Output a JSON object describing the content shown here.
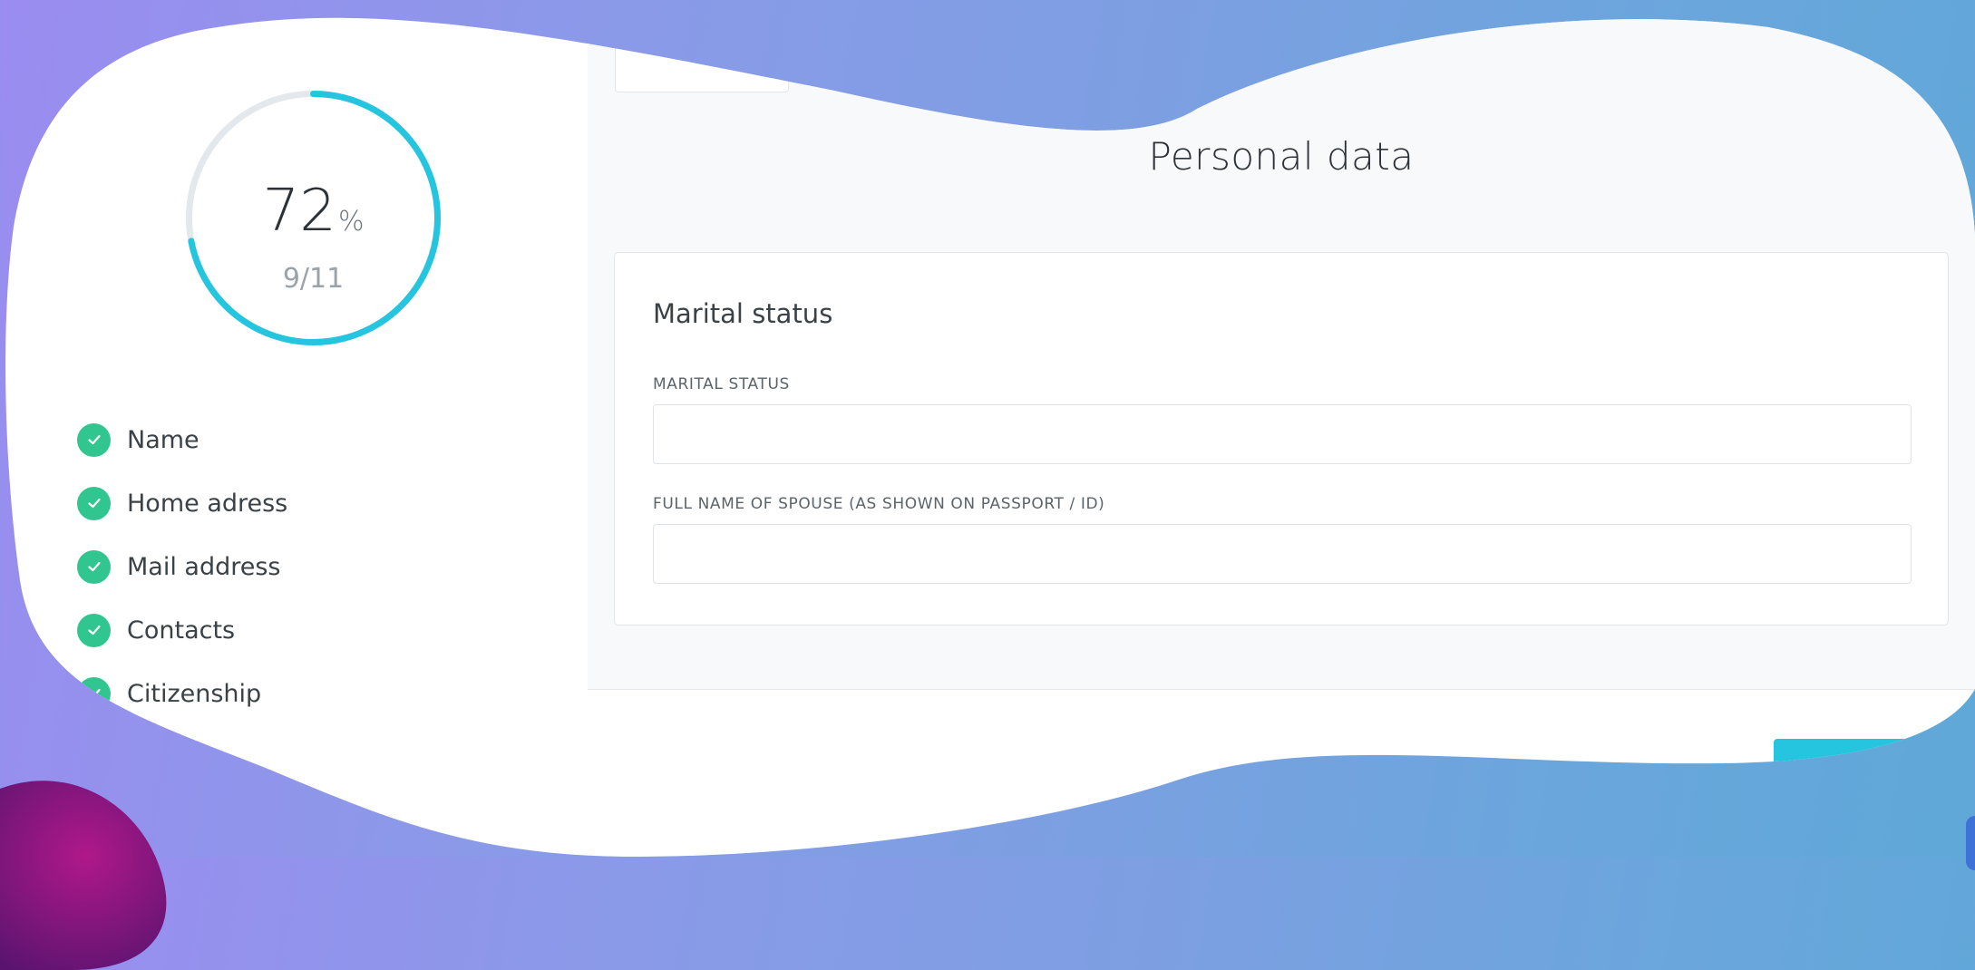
{
  "progress": {
    "percent": 72,
    "percent_value": "72",
    "percent_sign": "%",
    "count": "9/11"
  },
  "steps": [
    {
      "label": "Name",
      "done": true
    },
    {
      "label": "Home adress",
      "done": true
    },
    {
      "label": "Mail address",
      "done": true
    },
    {
      "label": "Contacts",
      "done": true
    },
    {
      "label": "Citizenship",
      "done": true
    }
  ],
  "main": {
    "title": "Personal data",
    "section": {
      "title": "Marital status",
      "fields": [
        {
          "label": "MARITAL STATUS",
          "value": ""
        },
        {
          "label": "FULL NAME OF SPOUSE (AS SHOWN ON PASSPORT / ID)",
          "value": ""
        }
      ]
    }
  },
  "colors": {
    "accent": "#25c5df",
    "success": "#31c68f",
    "ring_track": "#e2e8ec"
  },
  "icons": {
    "step_done": "check-icon"
  }
}
